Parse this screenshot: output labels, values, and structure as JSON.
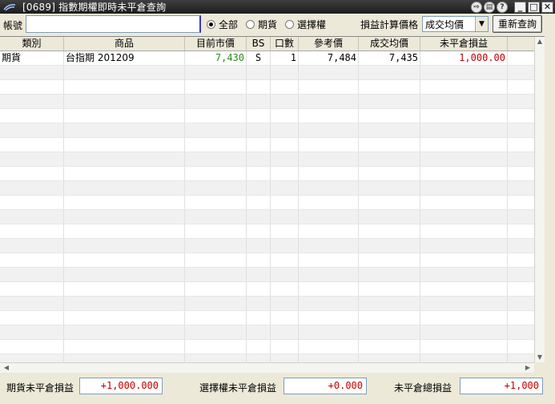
{
  "window": {
    "title": "[0689] 指數期權即時未平倉查詢",
    "controls": [
      "export-icon",
      "print-icon",
      "help-icon",
      "minimize-icon",
      "maximize-icon",
      "close-icon"
    ]
  },
  "toolbar": {
    "account_label": "帳號",
    "account_value": "",
    "radios": [
      {
        "label": "全部",
        "selected": true
      },
      {
        "label": "期貨",
        "selected": false
      },
      {
        "label": "選擇權",
        "selected": false
      }
    ],
    "price_label": "損益計算價格",
    "price_select": "成交均價",
    "requery_label": "重新查詢"
  },
  "grid": {
    "columns": [
      "類別",
      "商品",
      "目前市價",
      "BS",
      "口數",
      "參考價",
      "成交均價",
      "未平倉損益",
      ""
    ],
    "rows": [
      {
        "category": "期貨",
        "product": "台指期 201209",
        "market_price": "7,430",
        "bs": "S",
        "qty": "1",
        "ref_price": "7,484",
        "avg_price": "7,435",
        "unrealized_pl": "1,000.00"
      }
    ],
    "total_rows": 22
  },
  "footer": {
    "futures_label": "期貨未平倉損益",
    "futures_value": "+1,000.000",
    "options_label": "選擇權未平倉損益",
    "options_value": "+0.000",
    "total_label": "未平倉總損益",
    "total_value": "+1,000"
  },
  "colors": {
    "market_price": "#2e8b1e",
    "pl_positive": "#c00000",
    "titlebar": "#2a2a2a"
  }
}
